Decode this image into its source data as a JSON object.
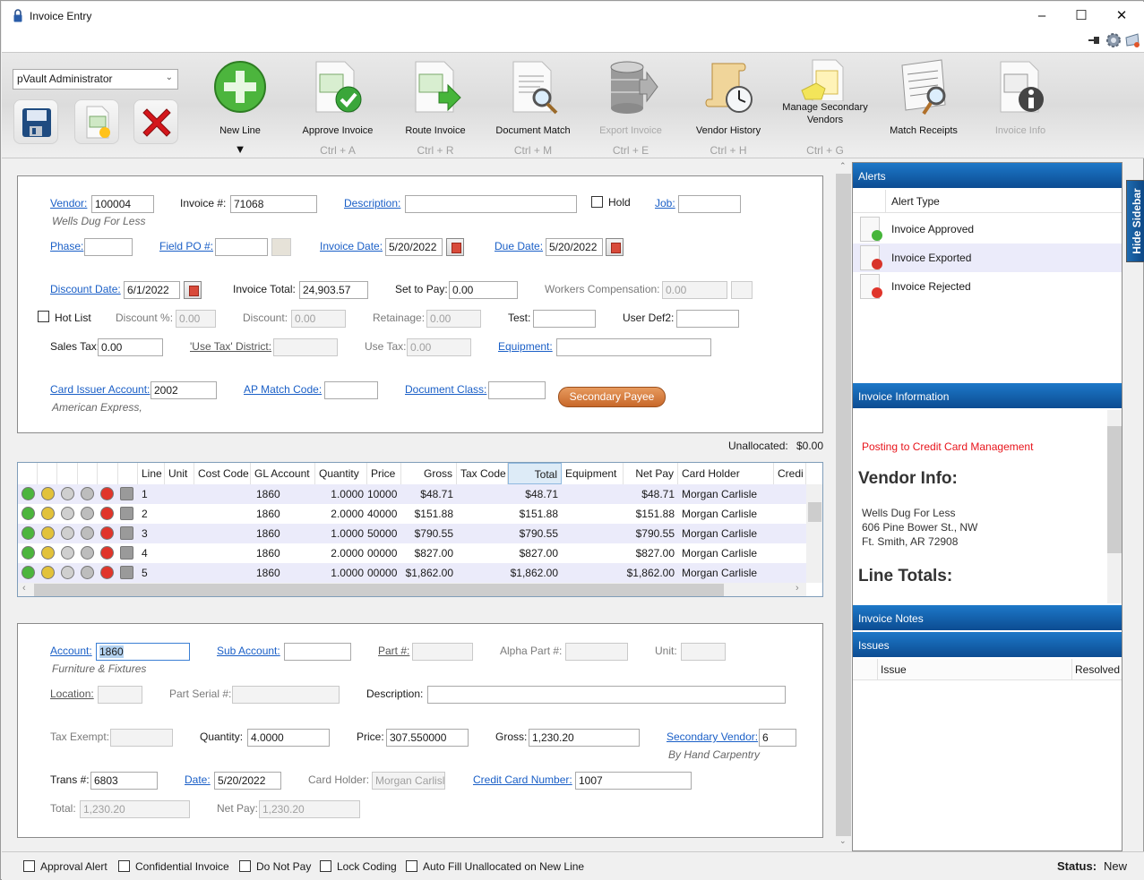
{
  "window": {
    "title": "Invoice Entry",
    "minimize": "–",
    "maximize": "☐",
    "close": "✕"
  },
  "toolbar": {
    "user_select": "pVault Administrator",
    "buttons": [
      {
        "label": "New Line",
        "shortcut": "▼",
        "icon": "plus-circle-icon",
        "enabled": true
      },
      {
        "label": "Approve Invoice",
        "shortcut": "Ctrl + A",
        "icon": "invoice-approve-icon",
        "enabled": true
      },
      {
        "label": "Route Invoice",
        "shortcut": "Ctrl + R",
        "icon": "invoice-route-icon",
        "enabled": true
      },
      {
        "label": "Document Match",
        "shortcut": "Ctrl + M",
        "icon": "document-search-icon",
        "enabled": true
      },
      {
        "label": "Export Invoice",
        "shortcut": "Ctrl + E",
        "icon": "database-export-icon",
        "enabled": false
      },
      {
        "label": "Vendor History",
        "shortcut": "Ctrl + H",
        "icon": "scroll-clock-icon",
        "enabled": true
      },
      {
        "label": "Manage Secondary Vendors",
        "shortcut": "Ctrl + G",
        "icon": "sales-quotation-icon",
        "enabled": true
      },
      {
        "label": "Match Receipts",
        "shortcut": "",
        "icon": "receipt-search-icon",
        "enabled": true
      },
      {
        "label": "Invoice Info",
        "shortcut": "",
        "icon": "invoice-info-icon",
        "enabled": false
      }
    ]
  },
  "header": {
    "vendor_label": "Vendor:",
    "vendor": "100004",
    "vendor_name": "Wells Dug For Less",
    "invoice_no_label": "Invoice #:",
    "invoice_no": "71068",
    "description_label": "Description:",
    "description": "",
    "hold_label": "Hold",
    "job_label": "Job:",
    "job": "",
    "phase_label": "Phase:",
    "phase": "",
    "field_po_label": "Field PO #:",
    "field_po": "",
    "invoice_date_label": "Invoice Date:",
    "invoice_date": "5/20/2022",
    "due_date_label": "Due Date:",
    "due_date": "5/20/2022",
    "discount_date_label": "Discount Date:",
    "discount_date": "6/1/2022",
    "invoice_total_label": "Invoice Total:",
    "invoice_total": "24,903.57",
    "set_to_pay_label": "Set to Pay:",
    "set_to_pay": "0.00",
    "workers_comp_label": "Workers Compensation:",
    "workers_comp": "0.00",
    "hot_list_label": "Hot List",
    "discount_pct_label": "Discount %:",
    "discount_pct": "0.00",
    "discount_label": "Discount:",
    "discount": "0.00",
    "retainage_label": "Retainage:",
    "retainage": "0.00",
    "test_label": "Test:",
    "test": "",
    "user_def2_label": "User Def2:",
    "user_def2": "",
    "sales_tax_label": "Sales Tax:",
    "sales_tax": "0.00",
    "use_tax_district_label": "'Use Tax' District:",
    "use_tax_district": "",
    "use_tax_label": "Use Tax:",
    "use_tax": "0.00",
    "equipment_label": "Equipment:",
    "equipment": "",
    "card_issuer_label": "Card Issuer Account:",
    "card_issuer": "2002",
    "card_issuer_name": "American Express,",
    "ap_match_label": "AP Match Code:",
    "ap_match": "",
    "doc_class_label": "Document Class:",
    "doc_class": "",
    "secondary_payee_button": "Secondary Payee"
  },
  "unallocated": {
    "label": "Unallocated:",
    "value": "$0.00"
  },
  "grid": {
    "columns": [
      "Line",
      "Unit",
      "Cost Code",
      "GL Account",
      "Quantity",
      "Price",
      "Gross",
      "Tax Code",
      "Total",
      "Equipment",
      "Net Pay",
      "Card Holder",
      "Credi"
    ],
    "rows": [
      {
        "line": "1",
        "unit": "",
        "cost_code": "",
        "gl": "1860",
        "qty": "1.0000",
        "price": "10000",
        "gross": "$48.71",
        "tax": "",
        "total": "$48.71",
        "equipment": "",
        "net": "$48.71",
        "holder": "Morgan Carlisle"
      },
      {
        "line": "2",
        "unit": "",
        "cost_code": "",
        "gl": "1860",
        "qty": "2.0000",
        "price": "40000",
        "gross": "$151.88",
        "tax": "",
        "total": "$151.88",
        "equipment": "",
        "net": "$151.88",
        "holder": "Morgan Carlisle"
      },
      {
        "line": "3",
        "unit": "",
        "cost_code": "",
        "gl": "1860",
        "qty": "1.0000",
        "price": "50000",
        "gross": "$790.55",
        "tax": "",
        "total": "$790.55",
        "equipment": "",
        "net": "$790.55",
        "holder": "Morgan Carlisle"
      },
      {
        "line": "4",
        "unit": "",
        "cost_code": "",
        "gl": "1860",
        "qty": "2.0000",
        "price": "00000",
        "gross": "$827.00",
        "tax": "",
        "total": "$827.00",
        "equipment": "",
        "net": "$827.00",
        "holder": "Morgan Carlisle"
      },
      {
        "line": "5",
        "unit": "",
        "cost_code": "",
        "gl": "1860",
        "qty": "1.0000",
        "price": "00000",
        "gross": "$1,862.00",
        "tax": "",
        "total": "$1,862.00",
        "equipment": "",
        "net": "$1,862.00",
        "holder": "Morgan Carlisle"
      }
    ]
  },
  "line_detail": {
    "account_label": "Account:",
    "account": "1860",
    "account_name": "Furniture & Fixtures",
    "sub_account_label": "Sub Account:",
    "sub_account": "",
    "part_label": "Part #:",
    "part": "",
    "alpha_part_label": "Alpha Part #:",
    "alpha_part": "",
    "unit_label": "Unit:",
    "unit": "",
    "location_label": "Location:",
    "location": "",
    "part_serial_label": "Part Serial #:",
    "part_serial": "",
    "description_label": "Description:",
    "description": "",
    "tax_exempt_label": "Tax Exempt:",
    "tax_exempt": "",
    "quantity_label": "Quantity:",
    "quantity": "4.0000",
    "price_label": "Price:",
    "price": "307.550000",
    "gross_label": "Gross:",
    "gross": "1,230.20",
    "secondary_vendor_label": "Secondary Vendor:",
    "secondary_vendor": "6",
    "secondary_vendor_name": "By Hand Carpentry",
    "trans_label": "Trans #:",
    "trans": "6803",
    "date_label": "Date:",
    "date": "5/20/2022",
    "card_holder_label": "Card Holder:",
    "card_holder": "Morgan Carlisl",
    "cc_number_label": "Credit Card Number:",
    "cc_number": "1007",
    "total_label": "Total:",
    "total": "1,230.20",
    "net_pay_label": "Net Pay:",
    "net_pay": "1,230.20"
  },
  "sidebar": {
    "hide_label": "Hide Sidebar",
    "alerts_title": "Alerts",
    "alert_type_header": "Alert Type",
    "alerts": [
      "Invoice Approved",
      "Invoice Exported",
      "Invoice Rejected"
    ],
    "invoice_info_title": "Invoice Information",
    "posting_note": "Posting to Credit Card Management",
    "vendor_info_heading": "Vendor Info:",
    "vendor_lines": [
      "Wells Dug For Less",
      "606 Pine Bower St., NW",
      "Ft. Smith, AR 72908"
    ],
    "line_totals_heading": "Line Totals:",
    "invoice_notes_title": "Invoice Notes",
    "issues_title": "Issues",
    "issues_columns": [
      "Issue",
      "Resolved"
    ]
  },
  "footer": {
    "checkboxes": [
      "Approval Alert",
      "Confidential Invoice",
      "Do Not Pay",
      "Lock Coding",
      "Auto Fill Unallocated on New Line"
    ],
    "status_label": "Status:",
    "status_value": "New"
  }
}
